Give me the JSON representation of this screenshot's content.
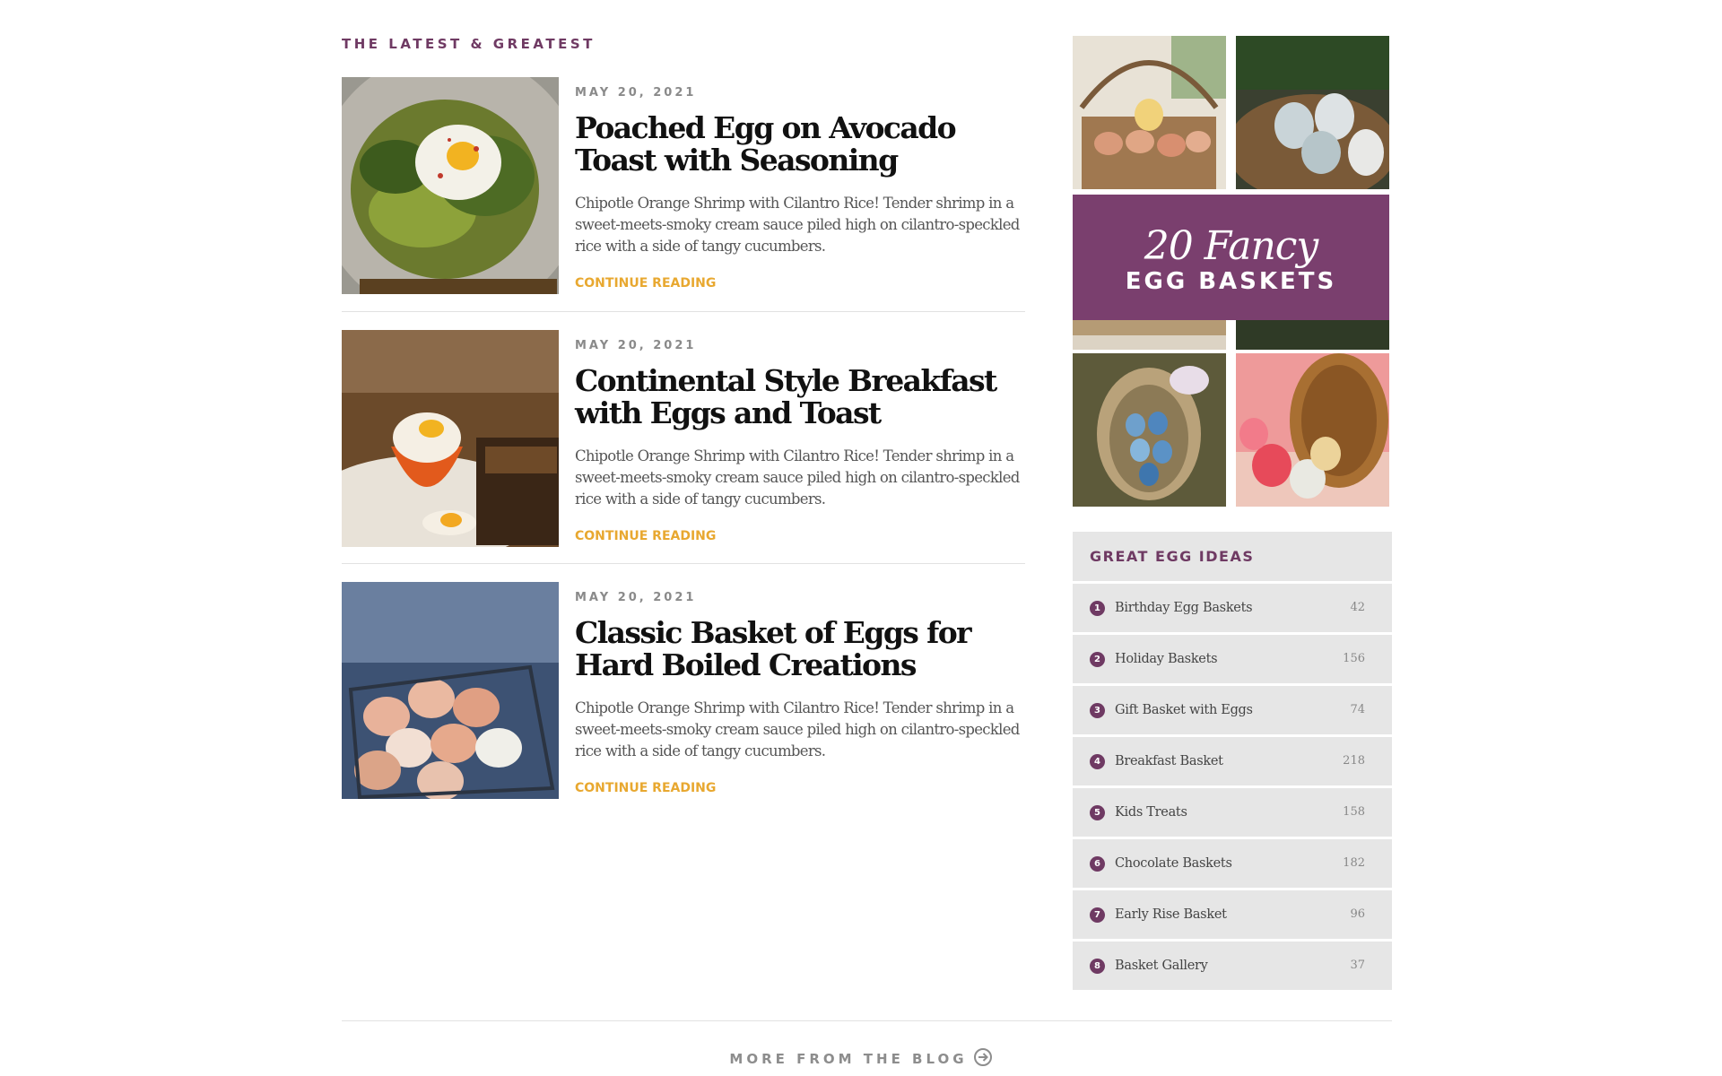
{
  "section_label": "THE LATEST & GREATEST",
  "posts": [
    {
      "date": "MAY 20, 2021",
      "title": "Poached Egg on Avocado Toast with Seasoning",
      "excerpt": "Chipotle Orange Shrimp with Cilantro Rice! Tender shrimp in a sweet-meets-smoky cream sauce piled high on cilantro-speckled rice with a side of tangy cucumbers.",
      "more": "CONTINUE READING"
    },
    {
      "date": "MAY 20, 2021",
      "title": "Continental Style Breakfast with Eggs and Toast",
      "excerpt": "Chipotle Orange Shrimp with Cilantro Rice! Tender shrimp in a sweet-meets-smoky cream sauce piled high on cilantro-speckled rice with a side of tangy cucumbers.",
      "more": "CONTINUE READING"
    },
    {
      "date": "MAY 20, 2021",
      "title": "Classic Basket of Eggs for Hard Boiled Creations",
      "excerpt": "Chipotle Orange Shrimp with Cilantro Rice! Tender shrimp in a sweet-meets-smoky cream sauce piled high on cilantro-speckled rice with a side of tangy cucumbers.",
      "more": "CONTINUE READING"
    }
  ],
  "promo": {
    "script": "20 Fancy",
    "main": "EGG BASKETS"
  },
  "widget": {
    "title": "GREAT EGG IDEAS",
    "items": [
      {
        "num": "1",
        "label": "Birthday Egg Baskets",
        "count": "42"
      },
      {
        "num": "2",
        "label": "Holiday Baskets",
        "count": "156"
      },
      {
        "num": "3",
        "label": "Gift Basket with Eggs",
        "count": "74"
      },
      {
        "num": "4",
        "label": "Breakfast Basket",
        "count": "218"
      },
      {
        "num": "5",
        "label": "Kids Treats",
        "count": "158"
      },
      {
        "num": "6",
        "label": "Chocolate Baskets",
        "count": "182"
      },
      {
        "num": "7",
        "label": "Early Rise Basket",
        "count": "96"
      },
      {
        "num": "8",
        "label": "Basket Gallery",
        "count": "37"
      }
    ]
  },
  "footer": {
    "more_label": "MORE FROM THE BLOG"
  },
  "colors": {
    "accent_plum": "#6f3a63",
    "promo_plum": "#7a3f6e",
    "link_gold": "#e8a830"
  }
}
